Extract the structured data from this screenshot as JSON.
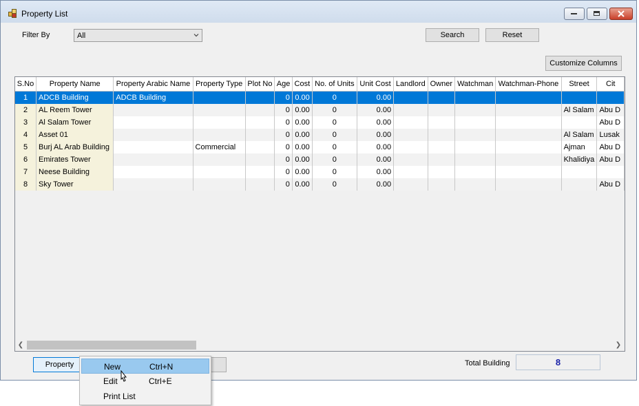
{
  "window": {
    "title": "Property List"
  },
  "filter": {
    "label": "Filter By",
    "value": "All"
  },
  "buttons": {
    "search": "Search",
    "reset": "Reset",
    "customize": "Customize Columns",
    "property": "Property"
  },
  "grid": {
    "columns": [
      "S.No",
      "Property Name",
      "Property Arabic Name",
      "Property Type",
      "Plot No",
      "Age",
      "Cost",
      "No. of Units",
      "Unit Cost",
      "Landlord",
      "Owner",
      "Watchman",
      "Watchman-Phone",
      "Street",
      "Cit"
    ],
    "rows": [
      {
        "sno": "1",
        "name": "ADCB Building",
        "arabic": "ADCB Building",
        "type": "",
        "plot": "",
        "age": "0",
        "cost": "0.00",
        "units": "0",
        "unit_cost": "0.00",
        "landlord": "",
        "owner": "",
        "watchman": "",
        "watchman_phone": "",
        "street": "",
        "city": ""
      },
      {
        "sno": "2",
        "name": "AL Reem Tower",
        "arabic": "",
        "type": "",
        "plot": "",
        "age": "0",
        "cost": "0.00",
        "units": "0",
        "unit_cost": "0.00",
        "landlord": "",
        "owner": "",
        "watchman": "",
        "watchman_phone": "",
        "street": "Al Salam",
        "city": "Abu D"
      },
      {
        "sno": "3",
        "name": "Al Salam Tower",
        "arabic": "",
        "type": "",
        "plot": "",
        "age": "0",
        "cost": "0.00",
        "units": "0",
        "unit_cost": "0.00",
        "landlord": "",
        "owner": "",
        "watchman": "",
        "watchman_phone": "",
        "street": "",
        "city": "Abu D"
      },
      {
        "sno": "4",
        "name": "Asset 01",
        "arabic": "",
        "type": "",
        "plot": "",
        "age": "0",
        "cost": "0.00",
        "units": "0",
        "unit_cost": "0.00",
        "landlord": "",
        "owner": "",
        "watchman": "",
        "watchman_phone": "",
        "street": "Al Salam",
        "city": "Lusak"
      },
      {
        "sno": "5",
        "name": "Burj AL Arab Building",
        "arabic": "",
        "type": "Commercial",
        "plot": "",
        "age": "0",
        "cost": "0.00",
        "units": "0",
        "unit_cost": "0.00",
        "landlord": "",
        "owner": "",
        "watchman": "",
        "watchman_phone": "",
        "street": "Ajman",
        "city": "Abu D"
      },
      {
        "sno": "6",
        "name": "Emirates Tower",
        "arabic": "",
        "type": "",
        "plot": "",
        "age": "0",
        "cost": "0.00",
        "units": "0",
        "unit_cost": "0.00",
        "landlord": "",
        "owner": "",
        "watchman": "",
        "watchman_phone": "",
        "street": "Khalidiya",
        "city": "Abu D"
      },
      {
        "sno": "7",
        "name": "Neese Building",
        "arabic": "",
        "type": "",
        "plot": "",
        "age": "0",
        "cost": "0.00",
        "units": "0",
        "unit_cost": "0.00",
        "landlord": "",
        "owner": "",
        "watchman": "",
        "watchman_phone": "",
        "street": "",
        "city": ""
      },
      {
        "sno": "8",
        "name": "Sky Tower",
        "arabic": "",
        "type": "",
        "plot": "",
        "age": "0",
        "cost": "0.00",
        "units": "0",
        "unit_cost": "0.00",
        "landlord": "",
        "owner": "",
        "watchman": "",
        "watchman_phone": "",
        "street": "",
        "city": "Abu D"
      }
    ]
  },
  "total": {
    "label": "Total Building",
    "value": "8"
  },
  "context_menu": {
    "items": [
      {
        "label": "New",
        "shortcut": "Ctrl+N"
      },
      {
        "label": "Edit",
        "shortcut": "Ctrl+E"
      },
      {
        "label": "Print List",
        "shortcut": ""
      }
    ]
  },
  "colors": {
    "selection": "#0078d7",
    "menu_highlight": "#99c9ef",
    "total_value": "#1a22a8"
  }
}
